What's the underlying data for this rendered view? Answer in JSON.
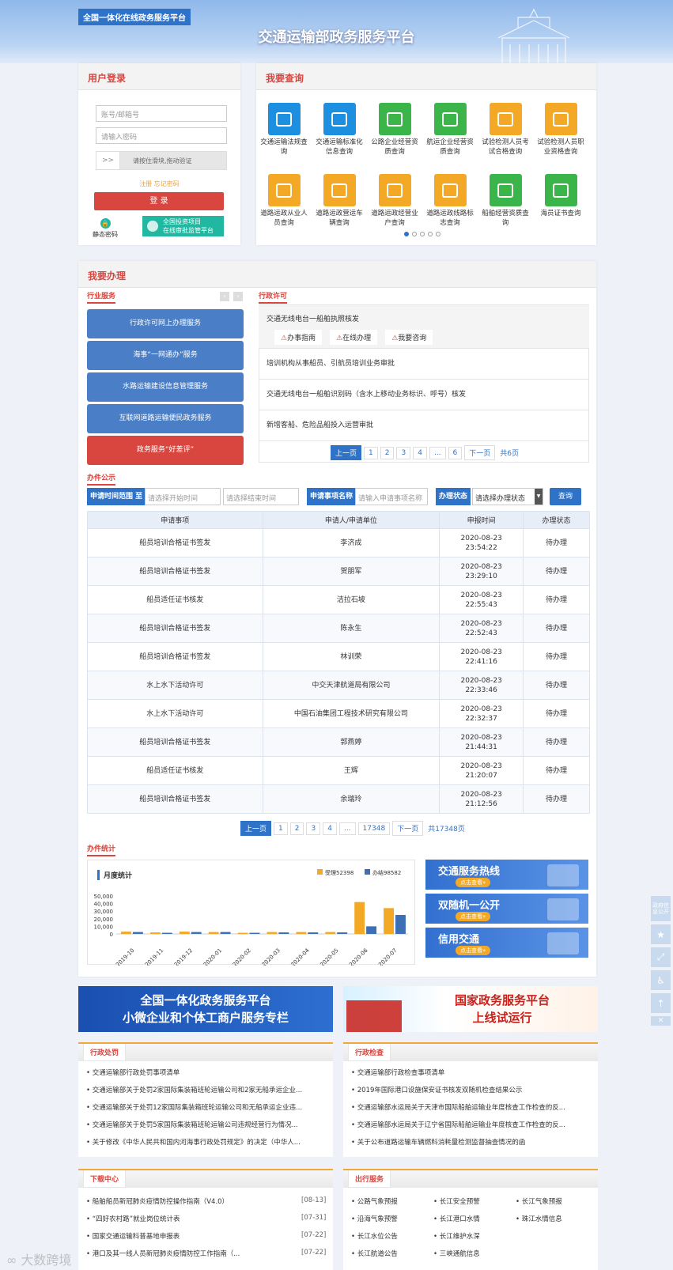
{
  "header": {
    "tag": "全国一体化在线政务服务平台",
    "title": "交通运输部政务服务平台"
  },
  "login": {
    "title": "用户登录",
    "account_placeholder": "账号/邮箱号",
    "password_placeholder": "请输入密码",
    "slider_arrow": ">>",
    "slider_text": "请按住滑块,拖动验证",
    "register": "注册",
    "forgot": "忘记密码",
    "login_btn": "登  录",
    "static_pwd": "静态密码",
    "invest_line1": "全国投资项目",
    "invest_line2": "在线审批监管平台"
  },
  "query": {
    "title": "我要查询",
    "items": [
      {
        "label": "交通运输法规查询",
        "color": "#1d8fe0"
      },
      {
        "label": "交通运输标准化信息查询",
        "color": "#1d8fe0"
      },
      {
        "label": "公路企业经营资质查询",
        "color": "#3bb54a"
      },
      {
        "label": "航运企业经营资质查询",
        "color": "#3bb54a"
      },
      {
        "label": "试验检测人员考试合格查询",
        "color": "#f3a925"
      },
      {
        "label": "试验检测人员职业资格查询",
        "color": "#f3a925"
      },
      {
        "label": "道路运政从业人员查询",
        "color": "#f3a925"
      },
      {
        "label": "道路运政营运车辆查询",
        "color": "#f3a925"
      },
      {
        "label": "道路运政经营业户查询",
        "color": "#f3a925"
      },
      {
        "label": "道路运政线路标志查询",
        "color": "#f3a925"
      },
      {
        "label": "船舶经营资质查询",
        "color": "#3bb54a"
      },
      {
        "label": "海员证书查询",
        "color": "#3bb54a"
      }
    ]
  },
  "handle": {
    "title": "我要办理",
    "industry_tab": "行业服务",
    "license_tab": "行政许可",
    "industry": [
      "行政许可网上办理服务",
      "海事“一网通办”服务",
      "水路运输建设信息管理服务",
      "互联网道路运输便民政务服务",
      "政务服务“好差评”"
    ],
    "licenses": [
      "交通无线电台一船舶执照核发",
      "培训机构从事船员、引航员培训业务审批",
      "交通无线电台一船舶识别码（含水上移动业务标识、呼号）核发",
      "新增客船、危险品船投入运营审批"
    ],
    "actions": [
      "办事指南",
      "在线办理",
      "我要咨询"
    ],
    "pager": [
      "上一页",
      "1",
      "2",
      "3",
      "4",
      "...",
      "6",
      "下一页",
      "共6页"
    ]
  },
  "publicity": {
    "tab": "办件公示",
    "time_label": "申请时间范围",
    "to": "至",
    "start_ph": "请选择开始时间",
    "end_ph": "请选择结束时间",
    "name_label": "申请事项名称",
    "name_ph": "请输入申请事项名称",
    "status_label": "办理状态",
    "status_ph": "请选择办理状态",
    "query_btn": "查询",
    "columns": [
      "申请事项",
      "申请人/申请单位",
      "申报时间",
      "办理状态"
    ],
    "rows": [
      {
        "item": "船员培训合格证书签发",
        "applicant": "李济成",
        "date": "2020-08-23",
        "time": "23:54:22",
        "status": "待办理"
      },
      {
        "item": "船员培训合格证书签发",
        "applicant": "贺朋军",
        "date": "2020-08-23",
        "time": "23:29:10",
        "status": "待办理"
      },
      {
        "item": "船员适任证书核发",
        "applicant": "洁拉石坡",
        "date": "2020-08-23",
        "time": "22:55:43",
        "status": "待办理"
      },
      {
        "item": "船员培训合格证书签发",
        "applicant": "陈永生",
        "date": "2020-08-23",
        "time": "22:52:43",
        "status": "待办理"
      },
      {
        "item": "船员培训合格证书签发",
        "applicant": "林训荣",
        "date": "2020-08-23",
        "time": "22:41:16",
        "status": "待办理"
      },
      {
        "item": "水上水下活动许可",
        "applicant": "中交天津航道局有限公司",
        "date": "2020-08-23",
        "time": "22:33:46",
        "status": "待办理"
      },
      {
        "item": "水上水下活动许可",
        "applicant": "中国石油集团工程技术研究有限公司",
        "date": "2020-08-23",
        "time": "22:32:37",
        "status": "待办理"
      },
      {
        "item": "船员培训合格证书签发",
        "applicant": "郭燕婷",
        "date": "2020-08-23",
        "time": "21:44:31",
        "status": "待办理"
      },
      {
        "item": "船员适任证书核发",
        "applicant": "王辉",
        "date": "2020-08-23",
        "time": "21:20:07",
        "status": "待办理"
      },
      {
        "item": "船员培训合格证书签发",
        "applicant": "余瑞玲",
        "date": "2020-08-23",
        "time": "21:12:56",
        "status": "待办理"
      }
    ],
    "pager": [
      "上一页",
      "1",
      "2",
      "3",
      "4",
      "...",
      "17348",
      "下一页",
      "共17348页"
    ]
  },
  "stats": {
    "tab": "办件统计",
    "chart_title": "月度统计",
    "promo": [
      {
        "title": "交通服务热线",
        "sub": "点击查看»"
      },
      {
        "title": "双随机一公开",
        "sub": "点击查看»"
      },
      {
        "title": "信用交通",
        "sub": "点击查看»"
      }
    ]
  },
  "chart_data": {
    "type": "bar",
    "title": "月度统计",
    "categories": [
      "2019-10",
      "2019-11",
      "2019-12",
      "2020-01",
      "2020-02",
      "2020-03",
      "2020-04",
      "2020-05",
      "2020-06",
      "2020-07"
    ],
    "series": [
      {
        "name": "受理52398",
        "color": "#f3a925",
        "values": [
          3000,
          2000,
          3000,
          2500,
          1500,
          2500,
          2500,
          2500,
          42000,
          34000
        ]
      },
      {
        "name": "办结98582",
        "color": "#3c6fb6",
        "values": [
          2500,
          1500,
          2500,
          2500,
          1500,
          2000,
          2000,
          2000,
          10000,
          25000
        ]
      }
    ],
    "yticks": [
      "50,000",
      "40,000",
      "30,000",
      "20,000",
      "10,000",
      "0"
    ],
    "ylim": [
      0,
      50000
    ]
  },
  "side": {
    "gov_open": "政府信息公开"
  },
  "banners": {
    "left_l1": "全国一体化政务服务平台",
    "left_l2": "小微企业和个体工商户服务专栏",
    "right_l1": "国家政务服务平台",
    "right_l2": "上线试运行"
  },
  "news": {
    "penalty": {
      "tab": "行政处罚",
      "items": [
        "交通运输部行政处罚事项清单",
        "交通运输部关于处罚2家国际集装箱班轮运输公司和2家无船承运企业...",
        "交通运输部关于处罚12家国际集装箱班轮运输公司和无船承运企业违...",
        "交通运输部关于处罚5家国际集装箱班轮运输公司违规经营行为情况...",
        "关于修改《中华人民共和国内河海事行政处罚规定》的决定（中华人..."
      ]
    },
    "inspect": {
      "tab": "行政检查",
      "items": [
        "交通运输部行政检查事项清单",
        "2019年国际港口设施保安证书核发双随机检查结果公示",
        "交通运输部水运局关于天津市国际船舶运输业年度核查工作检查的反...",
        "交通运输部水运局关于辽宁省国际船舶运输业年度核查工作检查的反...",
        "关于公布道路运输车辆燃料消耗量检测监督抽查情况的函"
      ]
    },
    "download": {
      "tab": "下载中心",
      "items": [
        {
          "t": "船舶船员新冠肺炎疫情防控操作指南（V4.0）",
          "d": "[08-13]"
        },
        {
          "t": "“四好农村路”就业岗位统计表",
          "d": "[07-31]"
        },
        {
          "t": "国家交通运输科普基地申报表",
          "d": "[07-22]"
        },
        {
          "t": "港口及其一线人员新冠肺炎疫情防控工作指南（...",
          "d": "[07-22]"
        }
      ]
    },
    "travel": {
      "tab": "出行服务",
      "cols": [
        [
          "公路气象预报",
          "沿海气象预警",
          "长江水位公告",
          "长江航道公告"
        ],
        [
          "长江安全预警",
          "长江港口水情",
          "长江维护水深",
          "三峡通航信息"
        ],
        [
          "长江气象预报",
          "珠江水情信息"
        ]
      ]
    }
  },
  "watermark": "大数跨境"
}
